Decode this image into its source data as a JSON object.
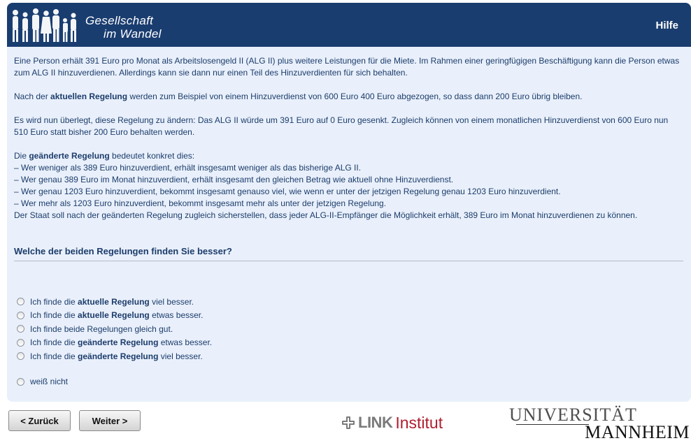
{
  "header": {
    "logo_line1": "Gesellschaft",
    "logo_line2": "im Wandel",
    "help_label": "Hilfe"
  },
  "intro": {
    "p1": "Eine Person erhält 391 Euro pro Monat als Arbeitslosengeld II (ALG II) plus weitere Leistungen für die Miete. Im Rahmen einer geringfügigen Beschäftigung kann die Person etwas zum ALG II hinzuverdienen. Allerdings kann sie dann nur einen Teil des Hinzuverdienten für sich behalten.",
    "p2_a": "Nach der ",
    "p2_b": "aktuellen Regelung",
    "p2_c": " werden zum Beispiel von einem Hinzuverdienst von 600 Euro 400 Euro abgezogen, so dass dann 200 Euro übrig bleiben.",
    "p3": "Es wird nun überlegt, diese Regelung zu ändern: Das ALG II würde um 391 Euro auf 0 Euro gesenkt. Zugleich können von einem monatlichen Hinzuverdienst von 600 Euro nun 510 Euro statt bisher 200 Euro behalten werden.",
    "p4_a": "Die ",
    "p4_b": "geänderte Regelung",
    "p4_c": " bedeutet konkret dies:",
    "bullets": [
      "– Wer weniger als 389 Euro hinzuverdient, erhält insgesamt weniger als das bisherige ALG II.",
      "– Wer genau 389 Euro im Monat hinzuverdient, erhält insgesamt den gleichen Betrag wie aktuell ohne Hinzuverdienst.",
      "– Wer genau 1203 Euro hinzuverdient, bekommt insgesamt genauso viel, wie wenn er unter der jetzigen Regelung genau 1203 Euro hinzuverdient.",
      "– Wer mehr als 1203 Euro hinzuverdient, bekommt insgesamt mehr als unter der jetzigen Regelung."
    ],
    "p5": "Der Staat soll nach der geänderten Regelung zugleich sicherstellen, dass jeder ALG-II-Empfänger die Möglichkeit erhält, 389 Euro im Monat hinzuverdienen zu können."
  },
  "question": "Welche der beiden Regelungen finden Sie besser?",
  "options": [
    {
      "pre": "Ich finde die ",
      "bold": "aktuelle Regelung",
      "post": " viel besser."
    },
    {
      "pre": "Ich finde die ",
      "bold": "aktuelle Regelung",
      "post": " etwas besser."
    },
    {
      "pre": "Ich finde beide Regelungen gleich gut.",
      "bold": "",
      "post": ""
    },
    {
      "pre": "Ich finde die ",
      "bold": "geänderte Regelung",
      "post": " etwas besser."
    },
    {
      "pre": "Ich finde die ",
      "bold": "geänderte Regelung",
      "post": " viel besser."
    },
    {
      "pre": "weiß nicht",
      "bold": "",
      "post": ""
    }
  ],
  "nav": {
    "back_label": "< Zurück",
    "next_label": "Weiter >"
  },
  "footer": {
    "link_word": "LINK",
    "institut_word": "Institut",
    "uni_line1": "UNIVERSITÄT",
    "uni_line2": "MANNHEIM"
  },
  "colors": {
    "header_bg": "#1a3d70",
    "content_bg": "#e9f0fb",
    "text": "#1c3c6b",
    "institut_red": "#b01e2f"
  }
}
